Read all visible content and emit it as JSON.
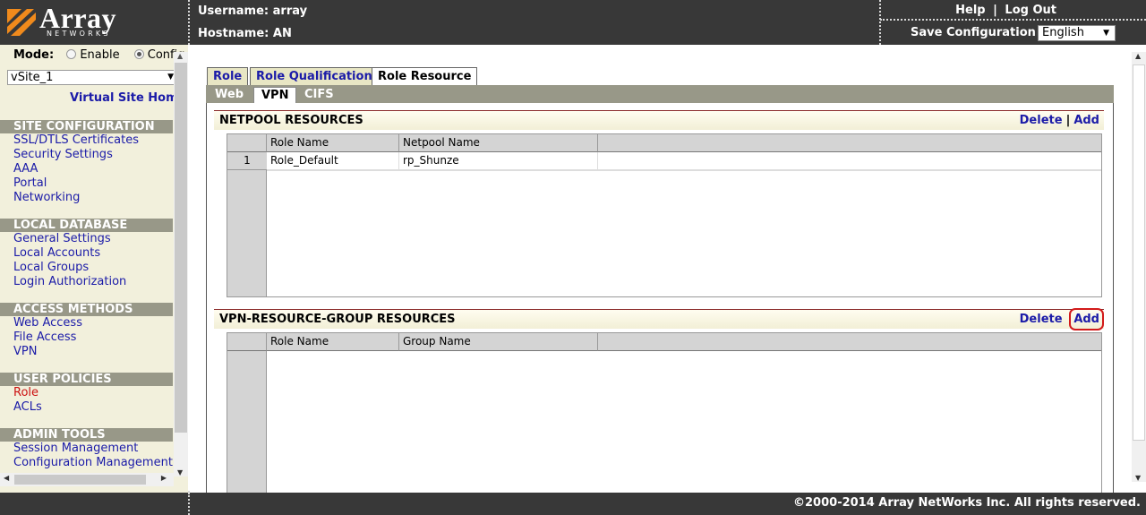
{
  "header": {
    "logo_text": "Array",
    "logo_sub": "NETWORKS",
    "username_label": "Username: array",
    "hostname_label": "Hostname: AN",
    "help_label": "Help",
    "logout_label": "Log Out",
    "link_sep": "|",
    "save_config_label": "Save Configuration |",
    "language_selected": "English"
  },
  "sidebar": {
    "mode_label": "Mode:",
    "mode_enable": "Enable",
    "mode_config": "Config",
    "vsite_selected": "vSite_1",
    "vsite_home": "Virtual Site Home",
    "sections": [
      {
        "title": "SITE CONFIGURATION",
        "items": [
          "SSL/DTLS Certificates",
          "Security Settings",
          "AAA",
          "Portal",
          "Networking"
        ]
      },
      {
        "title": "LOCAL DATABASE",
        "items": [
          "General Settings",
          "Local Accounts",
          "Local Groups",
          "Login Authorization"
        ]
      },
      {
        "title": "ACCESS METHODS",
        "items": [
          "Web Access",
          "File Access",
          "VPN"
        ]
      },
      {
        "title": "USER POLICIES",
        "items": [
          "Role",
          "ACLs"
        ]
      },
      {
        "title": "ADMIN TOOLS",
        "items": [
          "Session Management",
          "Configuration Management"
        ]
      }
    ]
  },
  "tabs": {
    "top": [
      "Role",
      "Role Qualification",
      "Role Resource"
    ],
    "sub": [
      "Web",
      "VPN",
      "CIFS"
    ]
  },
  "netpool": {
    "title": "NETPOOL RESOURCES",
    "delete_label": "Delete",
    "sep": "|",
    "add_label": "Add",
    "columns": [
      "Role Name",
      "Netpool Name"
    ],
    "rows": [
      {
        "num": "1",
        "role": "Role_Default",
        "netpool": "rp_Shunze"
      }
    ]
  },
  "vpn_group": {
    "title": "VPN-RESOURCE-GROUP RESOURCES",
    "delete_label": "Delete",
    "add_label": "Add",
    "columns": [
      "Role Name",
      "Group Name"
    ]
  },
  "footer": {
    "copyright": "©2000-2014 Array NetWorks Inc. All rights reserved."
  },
  "colors": {
    "header_bg": "#383838",
    "sidebar_bg": "#f2f0dc",
    "link": "#1b1ba8",
    "active_link": "#cc1111",
    "highlight": "#d21a1a"
  }
}
